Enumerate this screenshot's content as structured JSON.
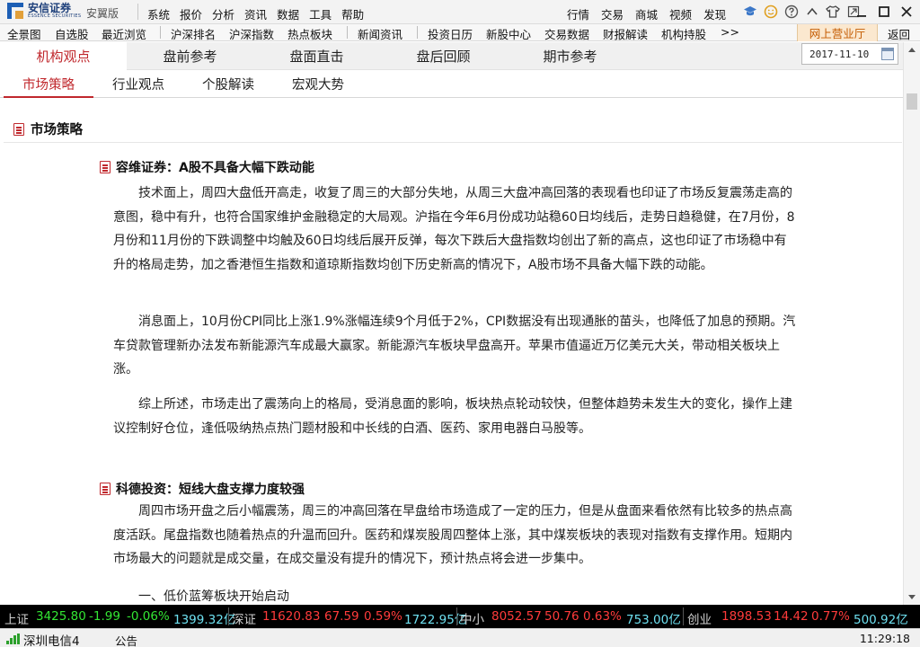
{
  "app": {
    "brand": "安信证券",
    "brand_en": "ESSENCE SECURITIES",
    "edition": "安翼版"
  },
  "menu": [
    "系统",
    "报价",
    "分析",
    "资讯",
    "数据",
    "工具",
    "帮助"
  ],
  "right_menu": [
    "行情",
    "交易",
    "商城",
    "视频",
    "发现"
  ],
  "nav": {
    "items": [
      "全景图",
      "自选股",
      "最近浏览",
      "沪深排名",
      "沪深指数",
      "热点板块",
      "新闻资讯",
      "投资日历",
      "新股中心",
      "交易数据",
      "财报解读",
      "机构持股",
      ">>"
    ],
    "online_hall": "网上营业厅",
    "back": "返回"
  },
  "main_tabs": [
    "机构观点",
    "盘前参考",
    "盘面直击",
    "盘后回顾",
    "期市参考"
  ],
  "main_active": 0,
  "date": "2017-11-10",
  "sub_tabs": [
    "市场策略",
    "行业观点",
    "个股解读",
    "宏观大势"
  ],
  "sub_active": 0,
  "section_title": "市场策略",
  "articles": [
    {
      "title": "容维证券：A股不具备大幅下跌动能",
      "paragraphs": [
        "技术面上，周四大盘低开高走，收复了周三的大部分失地，从周三大盘冲高回落的表现看也印证了市场反复震荡走高的意图，稳中有升，也符合国家维护金融稳定的大局观。沪指在今年6月份成功站稳60日均线后，走势日趋稳健，在7月份，8月份和11月份的下跌调整中均触及60日均线后展开反弹，每次下跌后大盘指数均创出了新的高点，这也印证了市场稳中有升的格局走势，加之香港恒生指数和道琼斯指数均创下历史新高的情况下，A股市场不具备大幅下跌的动能。",
        "消息面上，10月份CPI同比上涨1.9%涨幅连续9个月低于2%，CPI数据没有出现通胀的苗头，也降低了加息的预期。汽车贷款管理新办法发布新能源汽车成最大赢家。新能源汽车板块早盘高开。苹果市值逼近万亿美元大关，带动相关板块上涨。",
        "综上所述，市场走出了震荡向上的格局，受消息面的影响，板块热点轮动较快，但整体趋势未发生大的变化，操作上建议控制好仓位，逢低吸纳热点热门题材股和中长线的白酒、医药、家用电器白马股等。"
      ]
    },
    {
      "title": "科德投资：短线大盘支撑力度较强",
      "paragraphs": [
        "周四市场开盘之后小幅震荡，周三的冲高回落在早盘给市场造成了一定的压力，但是从盘面来看依然有比较多的热点高度活跃。尾盘指数也随着热点的升温而回升。医药和煤炭股周四整体上涨，其中煤炭板块的表现对指数有支撑作用。短期内市场最大的问题就是成交量，在成交量没有提升的情况下，预计热点将会进一步集中。"
      ],
      "subhead": "一、低价蓝筹板块开始启动"
    }
  ],
  "ticker": [
    {
      "name": "上证",
      "price": "3425.80",
      "change": "-1.99",
      "pct": "-0.06%",
      "volume": "1399.32亿",
      "dir": "down"
    },
    {
      "name": "深证",
      "price": "11620.83",
      "change": "67.59",
      "pct": "0.59%",
      "volume": "1722.95亿",
      "dir": "up"
    },
    {
      "name": "中小",
      "price": "8052.57",
      "change": "50.76",
      "pct": "0.63%",
      "volume": "753.00亿",
      "dir": "up"
    },
    {
      "name": "创业",
      "price": "1898.53",
      "change": "14.42",
      "pct": "0.77%",
      "volume": "500.92亿",
      "dir": "up"
    }
  ],
  "status": {
    "server": "深圳电信4",
    "notice": "公告",
    "time": "11:29:18"
  },
  "colors": {
    "accent_red": "#c0282d",
    "online_hall_bg": "#fbe8cf",
    "ticker_up": "#ff3b3b",
    "ticker_down": "#33e633",
    "ticker_volume": "#6ee0f0"
  }
}
